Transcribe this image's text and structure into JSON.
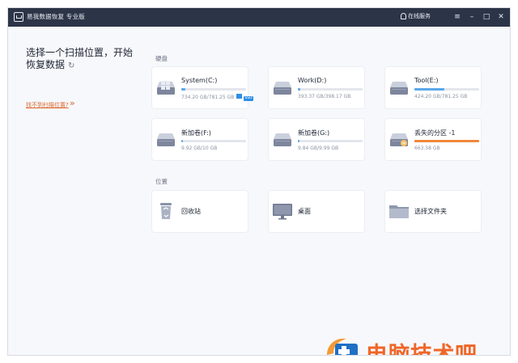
{
  "app": {
    "title": "易我数据恢复 专业版",
    "online_service": "在线服务"
  },
  "titlebar": {
    "menu_icon": "menu-icon",
    "minimize_icon": "minimize-icon",
    "maximize_icon": "maximize-icon",
    "close_icon": "close-icon"
  },
  "left": {
    "heading": "选择一个扫描位置，开始恢复数据",
    "cant_find_link": "找不到扫描位置?"
  },
  "sections": {
    "drives": "硬盘",
    "locations": "位置"
  },
  "drives": [
    {
      "name": "System(C:)",
      "size": "734.20 GB/781.25 GB",
      "fill": 0.06,
      "badges": true,
      "color": "#5aa8ea"
    },
    {
      "name": "Work(D:)",
      "size": "393.37 GB/398.17 GB",
      "fill": 0.04,
      "badges": false,
      "color": "#5aa8ea"
    },
    {
      "name": "Tool(E:)",
      "size": "424.20 GB/781.25 GB",
      "fill": 0.46,
      "badges": false,
      "color": "#5aa8ea"
    },
    {
      "name": "新加卷(F:)",
      "size": "9.92 GB/10 GB",
      "fill": 0.02,
      "badges": false,
      "color": "#5aa8ea"
    },
    {
      "name": "新加卷(G:)",
      "size": "9.84 GB/9.99 GB",
      "fill": 0.03,
      "badges": false,
      "color": "#5aa8ea"
    },
    {
      "name": "丢失的分区 -1",
      "size": "663.58 GB",
      "fill": 1.0,
      "badges": false,
      "color": "#f0883a"
    }
  ],
  "locations": [
    {
      "name": "回收站",
      "icon": "recycle-bin-icon"
    },
    {
      "name": "桌面",
      "icon": "desktop-icon"
    },
    {
      "name": "选择文件夹",
      "icon": "folder-icon"
    }
  ],
  "watermark": {
    "text": "电脑技术吧"
  }
}
